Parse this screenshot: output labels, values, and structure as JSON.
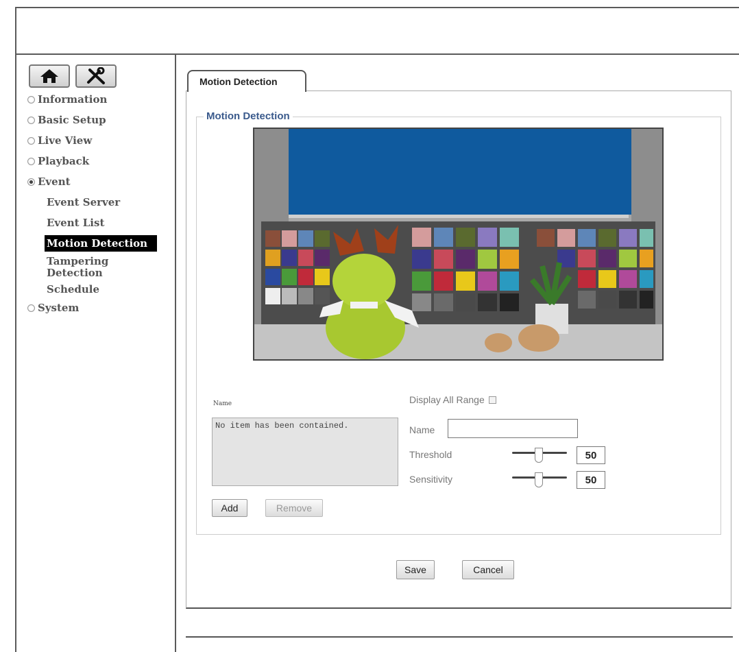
{
  "sidebar": {
    "menu": [
      {
        "label": "Information"
      },
      {
        "label": "Basic Setup"
      },
      {
        "label": "Live View"
      },
      {
        "label": "Playback"
      },
      {
        "label": "Event"
      }
    ],
    "event_sub": [
      {
        "label": "Event Server"
      },
      {
        "label": "Event List"
      },
      {
        "label": "Motion Detection"
      },
      {
        "label": "Tampering Detection"
      },
      {
        "label": "Schedule"
      }
    ],
    "system_label": "System",
    "home_icon": "home-icon",
    "settings_icon": "tools-icon"
  },
  "main": {
    "tab_label": "Motion Detection",
    "section_title": "Motion Detection",
    "list_label": "Name",
    "list_empty_text": "No item has been contained.",
    "add_label": "Add",
    "remove_label": "Remove",
    "display_all_label": "Display All Range",
    "name_label": "Name",
    "name_value": "",
    "threshold_label": "Threshold",
    "threshold_value": "50",
    "sensitivity_label": "Sensitivity",
    "sensitivity_value": "50",
    "save_label": "Save",
    "cancel_label": "Cancel"
  },
  "colors": {
    "section_title": "#3a5a8c",
    "active_item_bg": "#000000"
  }
}
